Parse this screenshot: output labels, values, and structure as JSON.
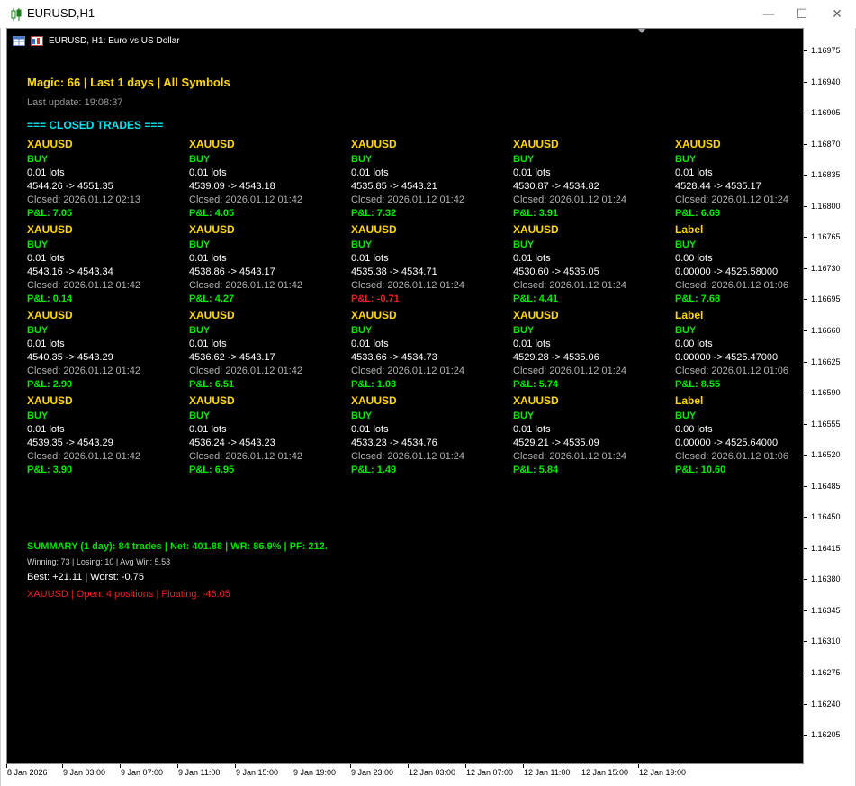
{
  "window": {
    "title": "EURUSD,H1",
    "min_glyph": "—",
    "max_glyph": "☐",
    "close_glyph": "✕"
  },
  "chart": {
    "header_text": "EURUSD, H1:  Euro vs US Dollar",
    "magic_line": "Magic: 66 | Last 1 days | All Symbols",
    "last_update": "Last update: 19:08:37",
    "closed_header": "=== CLOSED TRADES ==="
  },
  "trades": [
    {
      "symbol": "XAUUSD",
      "side": "BUY",
      "lots": "0.01 lots",
      "prices": "4544.26 -> 4551.35",
      "closed": "Closed: 2026.01.12 02:13",
      "pl": "P&L: 7.05",
      "pl_sign": "pos"
    },
    {
      "symbol": "XAUUSD",
      "side": "BUY",
      "lots": "0.01 lots",
      "prices": "4539.09 -> 4543.18",
      "closed": "Closed: 2026.01.12 01:42",
      "pl": "P&L: 4.05",
      "pl_sign": "pos"
    },
    {
      "symbol": "XAUUSD",
      "side": "BUY",
      "lots": "0.01 lots",
      "prices": "4535.85 -> 4543.21",
      "closed": "Closed: 2026.01.12 01:42",
      "pl": "P&L: 7.32",
      "pl_sign": "pos"
    },
    {
      "symbol": "XAUUSD",
      "side": "BUY",
      "lots": "0.01 lots",
      "prices": "4530.87 -> 4534.82",
      "closed": "Closed: 2026.01.12 01:24",
      "pl": "P&L: 3.91",
      "pl_sign": "pos"
    },
    {
      "symbol": "XAUUSD",
      "side": "BUY",
      "lots": "0.01 lots",
      "prices": "4528.44 -> 4535.17",
      "closed": "Closed: 2026.01.12 01:24",
      "pl": "P&L: 6.69",
      "pl_sign": "pos"
    },
    {
      "symbol": "XAUUSD",
      "side": "BUY",
      "lots": "0.01 lots",
      "prices": "4543.16 -> 4543.34",
      "closed": "Closed: 2026.01.12 01:42",
      "pl": "P&L: 0.14",
      "pl_sign": "pos"
    },
    {
      "symbol": "XAUUSD",
      "side": "BUY",
      "lots": "0.01 lots",
      "prices": "4538.86 -> 4543.17",
      "closed": "Closed: 2026.01.12 01:42",
      "pl": "P&L: 4.27",
      "pl_sign": "pos"
    },
    {
      "symbol": "XAUUSD",
      "side": "BUY",
      "lots": "0.01 lots",
      "prices": "4535.38 -> 4534.71",
      "closed": "Closed: 2026.01.12 01:24",
      "pl": "P&L: -0.71",
      "pl_sign": "neg"
    },
    {
      "symbol": "XAUUSD",
      "side": "BUY",
      "lots": "0.01 lots",
      "prices": "4530.60 -> 4535.05",
      "closed": "Closed: 2026.01.12 01:24",
      "pl": "P&L: 4.41",
      "pl_sign": "pos"
    },
    {
      "symbol": "Label",
      "side": "BUY",
      "lots": "0.00 lots",
      "prices": "0.00000 -> 4525.58000",
      "closed": "Closed: 2026.01.12 01:06",
      "pl": "P&L: 7.68",
      "pl_sign": "pos"
    },
    {
      "symbol": "XAUUSD",
      "side": "BUY",
      "lots": "0.01 lots",
      "prices": "4540.35 -> 4543.29",
      "closed": "Closed: 2026.01.12 01:42",
      "pl": "P&L: 2.90",
      "pl_sign": "pos"
    },
    {
      "symbol": "XAUUSD",
      "side": "BUY",
      "lots": "0.01 lots",
      "prices": "4536.62 -> 4543.17",
      "closed": "Closed: 2026.01.12 01:42",
      "pl": "P&L: 6.51",
      "pl_sign": "pos"
    },
    {
      "symbol": "XAUUSD",
      "side": "BUY",
      "lots": "0.01 lots",
      "prices": "4533.66 -> 4534.73",
      "closed": "Closed: 2026.01.12 01:24",
      "pl": "P&L: 1.03",
      "pl_sign": "pos"
    },
    {
      "symbol": "XAUUSD",
      "side": "BUY",
      "lots": "0.01 lots",
      "prices": "4529.28 -> 4535.06",
      "closed": "Closed: 2026.01.12 01:24",
      "pl": "P&L: 5.74",
      "pl_sign": "pos"
    },
    {
      "symbol": "Label",
      "side": "BUY",
      "lots": "0.00 lots",
      "prices": "0.00000 -> 4525.47000",
      "closed": "Closed: 2026.01.12 01:06",
      "pl": "P&L: 8.55",
      "pl_sign": "pos"
    },
    {
      "symbol": "XAUUSD",
      "side": "BUY",
      "lots": "0.01 lots",
      "prices": "4539.35 -> 4543.29",
      "closed": "Closed: 2026.01.12 01:42",
      "pl": "P&L: 3.90",
      "pl_sign": "pos"
    },
    {
      "symbol": "XAUUSD",
      "side": "BUY",
      "lots": "0.01 lots",
      "prices": "4536.24 -> 4543.23",
      "closed": "Closed: 2026.01.12 01:42",
      "pl": "P&L: 6.95",
      "pl_sign": "pos"
    },
    {
      "symbol": "XAUUSD",
      "side": "BUY",
      "lots": "0.01 lots",
      "prices": "4533.23 -> 4534.76",
      "closed": "Closed: 2026.01.12 01:24",
      "pl": "P&L: 1.49",
      "pl_sign": "pos"
    },
    {
      "symbol": "XAUUSD",
      "side": "BUY",
      "lots": "0.01 lots",
      "prices": "4529.21 -> 4535.09",
      "closed": "Closed: 2026.01.12 01:24",
      "pl": "P&L: 5.84",
      "pl_sign": "pos"
    },
    {
      "symbol": "Label",
      "side": "BUY",
      "lots": "0.00 lots",
      "prices": "0.00000 -> 4525.64000",
      "closed": "Closed: 2026.01.12 01:06",
      "pl": "P&L: 10.60",
      "pl_sign": "pos"
    }
  ],
  "summary": {
    "line": "SUMMARY (1 day): 84 trades | Net: 401.88 | WR: 86.9% | PF: 212.",
    "win_lose": "Winning: 73 | Losing: 10 | Avg Win: 5.53",
    "best_worst": "Best: +21.11 | Worst: -0.75",
    "open_positions": "XAUUSD | Open: 4 positions | Floating: -46.05"
  },
  "price_axis": [
    "1.16975",
    "1.16940",
    "1.16905",
    "1.16870",
    "1.16835",
    "1.16800",
    "1.16765",
    "1.16730",
    "1.16695",
    "1.16660",
    "1.16625",
    "1.16590",
    "1.16555",
    "1.16520",
    "1.16485",
    "1.16450",
    "1.16415",
    "1.16380",
    "1.16345",
    "1.16310",
    "1.16275",
    "1.16240",
    "1.16205"
  ],
  "time_axis": [
    "8 Jan 2026",
    "9 Jan 03:00",
    "9 Jan 07:00",
    "9 Jan 11:00",
    "9 Jan 15:00",
    "9 Jan 19:00",
    "9 Jan 23:00",
    "12 Jan 03:00",
    "12 Jan 07:00",
    "12 Jan 11:00",
    "12 Jan 15:00",
    "12 Jan 19:00"
  ],
  "colors": {
    "chart_bg": "#000000",
    "gold": "#ffd700",
    "green": "#00ee00",
    "red": "#ee2020",
    "cyan": "#00e5ee"
  }
}
